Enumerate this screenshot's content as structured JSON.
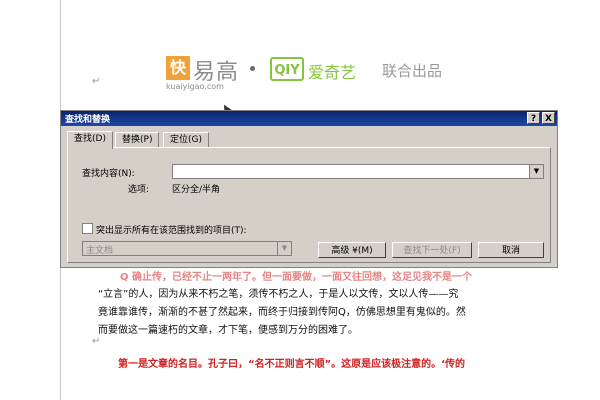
{
  "logos": {
    "kuai_char": "快",
    "kuai_name": "易高",
    "kuai_url": "kuaiyigao.com",
    "iqiyi_badge": "QIY",
    "iqiyi_name": "爱奇艺",
    "partner": "联合出品"
  },
  "dialog": {
    "title": "查找和替换",
    "help_label": "?",
    "close_label": "X",
    "tabs": [
      {
        "label": "查找(D)"
      },
      {
        "label": "替换(P)"
      },
      {
        "label": "定位(G)"
      }
    ],
    "find_label": "查找内容(N):",
    "find_value": "",
    "options_label": "选项:",
    "options_value": "区分全/半角",
    "highlight_label": "突出显示所有在该范围找到的项目(T):",
    "highlight_checked": false,
    "scope_value": "主文档",
    "more_button": "高级 ¥(M)",
    "find_next_button": "查找下一处(F)",
    "cancel_button": "取消"
  },
  "document": {
    "red_partial": "Q 确止传，已经不止一两年了。但一面要做，一面又往回想，这足见我不是一个",
    "lines": [
      "“立言”的人，因为从来不朽之笔，须传不朽之人，于是人以文传，文以人传——究",
      "竟谁靠谁传，渐渐的不甚了然起来，而终于归接到传阿Q，仿佛思想里有鬼似的。然",
      "而要做这一篇速朽的文章，才下笔，便感到万分的困难了。"
    ],
    "heading": "第一是文章的名目。孔子曰，“名不正则言不顺”。这原是应该极注意的。‘传的"
  }
}
